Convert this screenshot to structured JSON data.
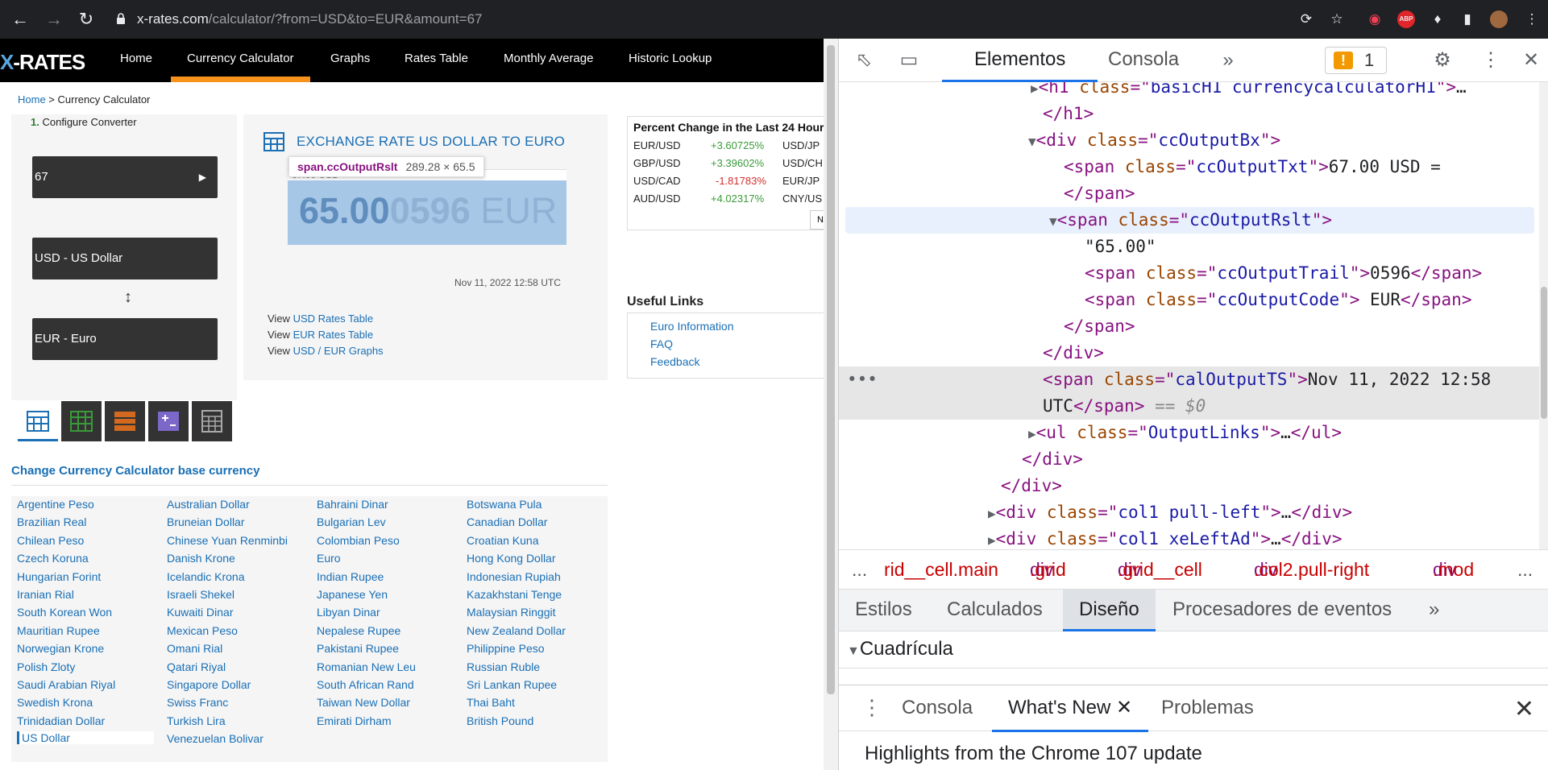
{
  "browser": {
    "url_host": "x-rates.com",
    "url_path": "/calculator/?from=USD&to=EUR&amount=67"
  },
  "site": {
    "logo": "X-RATES",
    "nav": [
      "Home",
      "Currency Calculator",
      "Graphs",
      "Rates Table",
      "Monthly Average",
      "Historic Lookup"
    ],
    "breadcrumb_home": "Home",
    "breadcrumb_sep": " > Currency Calculator"
  },
  "converter": {
    "step_num": "1.",
    "step_label": "Configure Converter",
    "amount": "67",
    "from": "USD - US Dollar",
    "to": "EUR - Euro"
  },
  "result": {
    "title": "EXCHANGE RATE US DOLLAR TO EURO",
    "output_txt": "67.00 USD =",
    "rslt_main": "65.00",
    "rslt_trail": "0596",
    "rslt_code": " EUR",
    "tooltip_class": "span.ccOutputRslt",
    "tooltip_dims": "289.28 × 65.5",
    "timestamp": "Nov 11, 2022 12:58 UTC",
    "view_word": "View",
    "links": [
      "USD Rates Table",
      "EUR Rates Table",
      "USD / EUR Graphs"
    ]
  },
  "percent_change": {
    "title": "Percent Change in the Last 24 Hours",
    "rows": [
      {
        "pair": "EUR/USD",
        "change": "+3.60725%",
        "sign": "pos",
        "pair2": "USD/JP"
      },
      {
        "pair": "GBP/USD",
        "change": "+3.39602%",
        "sign": "pos",
        "pair2": "USD/CH"
      },
      {
        "pair": "USD/CAD",
        "change": "-1.81783%",
        "sign": "neg",
        "pair2": "EUR/JP"
      },
      {
        "pair": "AUD/USD",
        "change": "+4.02317%",
        "sign": "pos",
        "pair2": "CNY/US"
      }
    ],
    "next_button": "N"
  },
  "useful_links": {
    "title": "Useful Links",
    "items": [
      "Euro Information",
      "FAQ",
      "Feedback"
    ]
  },
  "change_base": {
    "title": "Change Currency Calculator base currency",
    "columns": [
      [
        "Argentine Peso",
        "Brazilian Real",
        "Chilean Peso",
        "Czech Koruna",
        "Hungarian Forint",
        "Iranian Rial",
        "South Korean Won",
        "Mauritian Rupee",
        "Norwegian Krone",
        "Polish Zloty",
        "Saudi Arabian Riyal",
        "Swedish Krona",
        "Trinidadian Dollar",
        "US Dollar"
      ],
      [
        "Australian Dollar",
        "Bruneian Dollar",
        "Chinese Yuan Renminbi",
        "Danish Krone",
        "Icelandic Krona",
        "Israeli Shekel",
        "Kuwaiti Dinar",
        "Mexican Peso",
        "Omani Rial",
        "Qatari Riyal",
        "Singapore Dollar",
        "Swiss Franc",
        "Turkish Lira",
        "Venezuelan Bolivar"
      ],
      [
        "Bahraini Dinar",
        "Bulgarian Lev",
        "Colombian Peso",
        "Euro",
        "Indian Rupee",
        "Japanese Yen",
        "Libyan Dinar",
        "Nepalese Rupee",
        "Pakistani Rupee",
        "Romanian New Leu",
        "South African Rand",
        "Taiwan New Dollar",
        "Emirati Dirham"
      ],
      [
        "Botswana Pula",
        "Canadian Dollar",
        "Croatian Kuna",
        "Hong Kong Dollar",
        "Indonesian Rupiah",
        "Kazakhstani Tenge",
        "Malaysian Ringgit",
        "New Zealand Dollar",
        "Philippine Peso",
        "Russian Ruble",
        "Sri Lankan Rupee",
        "Thai Baht",
        "British Pound"
      ]
    ]
  },
  "devtools": {
    "tabs": [
      "Elementos",
      "Consola"
    ],
    "warning_count": "1",
    "dom": {
      "l0": [
        "<h1 ",
        "class",
        "=\"",
        "basicH1 currencycalculatorH1",
        "\">…"
      ],
      "l1": "</h1>",
      "l2": [
        "<div ",
        "class",
        "=\"",
        "ccOutputBx",
        "\">"
      ],
      "l3_tag": "<span ",
      "l3_attr": "class",
      "l3_val": "ccOutputTxt",
      "l3_text": "67.00 USD =",
      "l4": "</span>",
      "l5_val": "ccOutputRslt",
      "l6": "\"65.00\"",
      "l7_val": "ccOutputTrail",
      "l7_text": "0596",
      "l8_val": "ccOutputCode",
      "l8_text": " EUR",
      "l9": "</span>",
      "l10": "</div>",
      "l11_val": "calOutputTS",
      "l11_text": "Nov 11, 2022 12:58",
      "l12_text": "UTC",
      "l12_eq": " == $0",
      "l13_val": "OutputLinks",
      "l14": "</div>",
      "l15": "</div>",
      "l16_val": "col1 pull-left",
      "l17_val": "col1 xeLeftAd"
    },
    "breadcrumbs": [
      {
        "tag": "",
        "cls": "rid__cell.main"
      },
      {
        "tag": "div",
        "cls": ".grid"
      },
      {
        "tag": "div",
        "cls": ".grid__cell"
      },
      {
        "tag": "div",
        "cls": ".col2.pull-right"
      },
      {
        "tag": "div",
        "cls": ".mod"
      }
    ],
    "sub_tabs": [
      "Estilos",
      "Calculados",
      "Diseño",
      "Procesadores de eventos"
    ],
    "section": "Cuadrícula",
    "drawer_tabs": [
      "Consola",
      "What's New",
      "Problemas"
    ],
    "drawer_text": "Highlights from the Chrome 107 update"
  }
}
